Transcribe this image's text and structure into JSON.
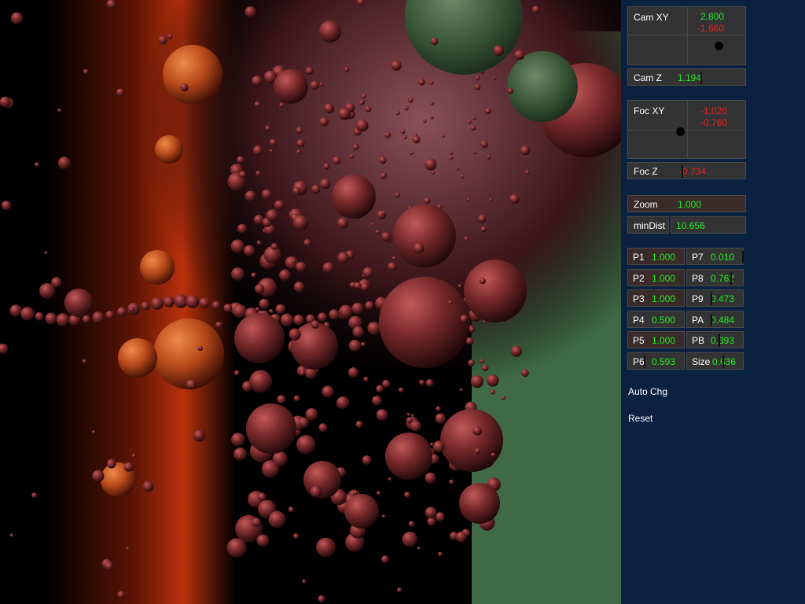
{
  "camera": {
    "xy_label": "Cam XY",
    "x_value": "2.800",
    "y_value": "-1.660",
    "z_label": "Cam Z",
    "z_value": "1.194"
  },
  "focus": {
    "xy_label": "Foc XY",
    "x_value": "-1.020",
    "y_value": "-0.760",
    "z_label": "Foc Z",
    "z_value": "-0.734"
  },
  "zoom": {
    "label": "Zoom",
    "value": "1.000"
  },
  "min_dist": {
    "label": "minDist",
    "value": "10.656"
  },
  "params": [
    {
      "label": "P1",
      "value": "1.000"
    },
    {
      "label": "P7",
      "value": "0.010"
    },
    {
      "label": "P2",
      "value": "1.000"
    },
    {
      "label": "P8",
      "value": "0.762"
    },
    {
      "label": "P3",
      "value": "1.000"
    },
    {
      "label": "P9",
      "value": "0.473"
    },
    {
      "label": "P4",
      "value": "0.500"
    },
    {
      "label": "PA",
      "value": "0.484"
    },
    {
      "label": "P5",
      "value": "1.000"
    },
    {
      "label": "PB",
      "value": "0.393"
    },
    {
      "label": "P6",
      "value": "0.593"
    },
    {
      "label": "Size",
      "value": "0.636"
    }
  ],
  "buttons": {
    "auto_change": "Auto Chg",
    "reset": "Reset"
  },
  "colors": {
    "panel_bg": "#0b2140",
    "control_bg": "#333333",
    "value_green": "#22ee22",
    "value_red": "#ee2222"
  }
}
